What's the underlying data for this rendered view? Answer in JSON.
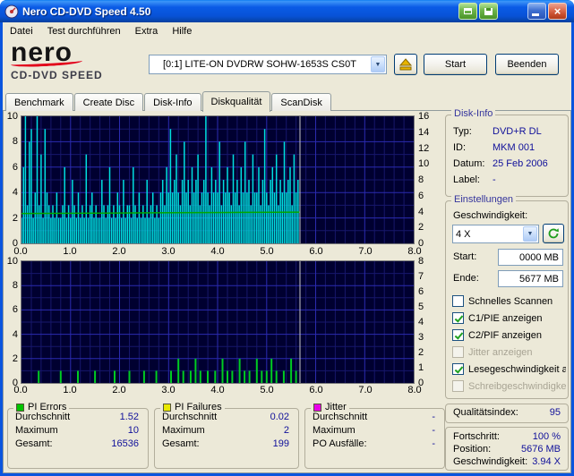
{
  "window": {
    "title": "Nero CD-DVD Speed 4.50"
  },
  "icons": {
    "chevron_down": "▼",
    "close": "×"
  },
  "menu": {
    "items": [
      "Datei",
      "Test durchführen",
      "Extra",
      "Hilfe"
    ]
  },
  "toolbar": {
    "logo_main": "nero",
    "logo_sub": "CD-DVD SPEED",
    "drive_value": "[0:1]  LITE-ON DVDRW SOHW-1653S CS0T",
    "start_label": "Start",
    "quit_label": "Beenden"
  },
  "tabs": {
    "items": [
      "Benchmark",
      "Create Disc",
      "Disk-Info",
      "Diskqualität",
      "ScanDisk"
    ],
    "active_index": 3
  },
  "disk_info": {
    "title": "Disk-Info",
    "rows": [
      {
        "label": "Typ:",
        "value": "DVD+R DL"
      },
      {
        "label": "ID:",
        "value": "MKM 001"
      },
      {
        "label": "Datum:",
        "value": "25 Feb 2006"
      },
      {
        "label": "Label:",
        "value": "-"
      }
    ]
  },
  "settings": {
    "title": "Einstellungen",
    "speed_label": "Geschwindigkeit:",
    "speed_value": "4 X",
    "start_label": "Start:",
    "start_value": "0000 MB",
    "end_label": "Ende:",
    "end_value": "5677 MB",
    "checkboxes": [
      {
        "label": "Schnelles Scannen",
        "checked": false,
        "enabled": true
      },
      {
        "label": "C1/PIE anzeigen",
        "checked": true,
        "enabled": true
      },
      {
        "label": "C2/PIF anzeigen",
        "checked": true,
        "enabled": true
      },
      {
        "label": "Jitter anzeigen",
        "checked": false,
        "enabled": false
      },
      {
        "label": "Lesegeschwindigkeit a",
        "checked": true,
        "enabled": true
      },
      {
        "label": "Schreibgeschwindigkei",
        "checked": false,
        "enabled": false
      }
    ]
  },
  "quality": {
    "label": "Qualitätsindex:",
    "value": "95"
  },
  "status": {
    "rows": [
      {
        "label": "Fortschritt:",
        "value": "100 %"
      },
      {
        "label": "Position:",
        "value": "5676 MB"
      },
      {
        "label": "Geschwindigkeit:",
        "value": "3.94 X"
      }
    ]
  },
  "stats": [
    {
      "title": "PI Errors",
      "chip_color": "#00C400",
      "rows": [
        {
          "label": "Durchschnitt",
          "value": "1.52"
        },
        {
          "label": "Maximum",
          "value": "10"
        },
        {
          "label": "Gesamt:",
          "value": "16536"
        }
      ]
    },
    {
      "title": "PI Failures",
      "chip_color": "#E8E800",
      "rows": [
        {
          "label": "Durchschnitt",
          "value": "0.02"
        },
        {
          "label": "Maximum",
          "value": "2"
        },
        {
          "label": "Gesamt:",
          "value": "199"
        }
      ]
    },
    {
      "title": "Jitter",
      "chip_color": "#E800E8",
      "rows": [
        {
          "label": "Durchschnitt",
          "value": "-"
        },
        {
          "label": "Maximum",
          "value": "-"
        },
        {
          "label": "PO Ausfälle:",
          "value": "-"
        }
      ]
    }
  ],
  "chart_data": [
    {
      "id": "pi-errors",
      "type": "bar",
      "title": "C1/PIE errors vs disc position (GB)",
      "xmax": 8,
      "ymax": 10,
      "x_ticks": [
        "0.0",
        "1.0",
        "2.0",
        "3.0",
        "4.0",
        "5.0",
        "6.0",
        "7.0",
        "8.0"
      ],
      "left_ticks": [
        "10",
        "8",
        "6",
        "4",
        "2",
        "0"
      ],
      "right_ticks": [
        "16",
        "14",
        "12",
        "10",
        "8",
        "6",
        "4",
        "2",
        "0"
      ],
      "grid": {
        "x_minor": 0.2,
        "x_major": 1,
        "y_minor": 1,
        "y_major": 2
      },
      "colors": {
        "bg": "#000030",
        "grid_minor": "#17176B",
        "grid_major": "#2B2BB0",
        "spikes": "#00E0E0",
        "line": "#00A800",
        "end_line": "#C8C8C8"
      },
      "end_line_x": 5.68,
      "spikes_series": {
        "x0": 0,
        "dx": 0.04,
        "values": [
          2,
          6,
          10,
          3,
          8,
          9,
          2,
          4,
          10,
          3,
          7,
          2,
          9,
          4,
          3,
          2,
          3,
          2,
          4,
          2,
          2,
          3,
          6,
          2,
          3,
          2,
          5,
          3,
          2,
          4,
          2,
          3,
          2,
          7,
          2,
          3,
          4,
          2,
          3,
          2,
          2,
          5,
          3,
          2,
          3,
          6,
          2,
          3,
          2,
          4,
          3,
          2,
          5,
          2,
          3,
          3,
          2,
          6,
          3,
          2,
          4,
          2,
          3,
          2,
          5,
          2,
          3,
          4,
          2,
          3,
          2,
          4,
          5,
          3,
          6,
          4,
          9,
          4,
          5,
          7,
          4,
          3,
          5,
          8,
          4,
          5,
          3,
          6,
          4,
          5,
          7,
          3,
          4,
          5,
          10,
          4,
          3,
          6,
          4,
          5,
          4,
          8,
          3,
          5,
          4,
          6,
          4,
          3,
          7,
          4,
          5,
          3,
          6,
          4,
          8,
          4,
          5,
          3,
          7,
          4,
          4,
          6,
          3,
          5,
          9,
          4,
          3,
          5,
          6,
          4,
          7,
          3,
          5,
          4,
          8,
          4,
          5,
          6,
          3,
          7,
          4,
          5
        ]
      },
      "speed_line": [
        [
          0,
          2.35
        ],
        [
          1.5,
          2.38
        ],
        [
          3,
          2.41
        ],
        [
          4.5,
          2.44
        ],
        [
          5.68,
          2.46
        ]
      ]
    },
    {
      "id": "pi-failures",
      "type": "bar",
      "title": "C2/PIF failures vs disc position (GB)",
      "xmax": 8,
      "ymax": 10,
      "x_ticks": [
        "0.0",
        "1.0",
        "2.0",
        "3.0",
        "4.0",
        "5.0",
        "6.0",
        "7.0",
        "8.0"
      ],
      "left_ticks": [
        "10",
        "8",
        "6",
        "4",
        "2",
        "0"
      ],
      "right_ticks": [
        "8",
        "7",
        "6",
        "5",
        "4",
        "3",
        "2",
        "1",
        "0"
      ],
      "grid": {
        "x_minor": 0.2,
        "x_major": 1,
        "y_minor": 1,
        "y_major": 2
      },
      "colors": {
        "bg": "#000030",
        "grid_minor": "#17176B",
        "grid_major": "#2B2BB0",
        "spikes": "#00CC22",
        "end_line": "#C8C8C8"
      },
      "end_line_x": 5.68,
      "spike_points": [
        [
          0.35,
          1
        ],
        [
          0.8,
          1
        ],
        [
          1.15,
          1
        ],
        [
          1.5,
          1
        ],
        [
          1.9,
          1
        ],
        [
          2.2,
          1
        ],
        [
          2.5,
          1
        ],
        [
          2.75,
          1
        ],
        [
          3.05,
          1
        ],
        [
          3.2,
          2
        ],
        [
          3.3,
          1
        ],
        [
          3.45,
          1
        ],
        [
          3.55,
          2
        ],
        [
          3.65,
          1
        ],
        [
          3.8,
          1
        ],
        [
          3.95,
          1
        ],
        [
          4.1,
          2
        ],
        [
          4.2,
          1
        ],
        [
          4.3,
          1
        ],
        [
          4.45,
          2
        ],
        [
          4.55,
          1
        ],
        [
          4.65,
          1
        ],
        [
          4.8,
          2
        ],
        [
          4.9,
          1
        ],
        [
          5.0,
          1
        ],
        [
          5.1,
          2
        ],
        [
          5.2,
          1
        ],
        [
          5.35,
          1
        ],
        [
          5.5,
          2
        ],
        [
          5.6,
          1
        ]
      ]
    }
  ]
}
